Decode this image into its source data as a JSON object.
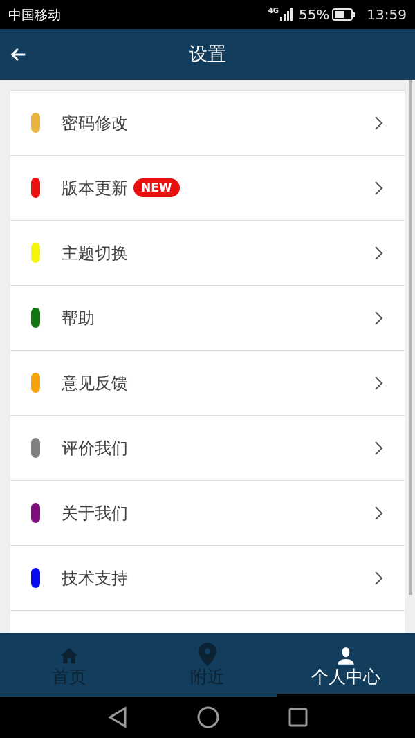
{
  "status_bar": {
    "carrier": "中国移动",
    "network": "4G",
    "battery": "55%",
    "time": "13:59"
  },
  "header": {
    "title": "设置"
  },
  "items": [
    {
      "label": "密码修改",
      "color": "#e8b33e"
    },
    {
      "label": "版本更新",
      "color": "#ee1111",
      "badge": "NEW"
    },
    {
      "label": "主题切换",
      "color": "#f5f50a"
    },
    {
      "label": "帮助",
      "color": "#117711"
    },
    {
      "label": "意见反馈",
      "color": "#f7a20a"
    },
    {
      "label": "评价我们",
      "color": "#808080"
    },
    {
      "label": "关于我们",
      "color": "#7d0f7d"
    },
    {
      "label": "技术支持",
      "color": "#0a0af0"
    }
  ],
  "tabs": [
    {
      "label": "首页",
      "kind": "home",
      "selected": false
    },
    {
      "label": "附近",
      "kind": "pin",
      "selected": false
    },
    {
      "label": "个人中心",
      "kind": "user",
      "selected": true
    }
  ]
}
